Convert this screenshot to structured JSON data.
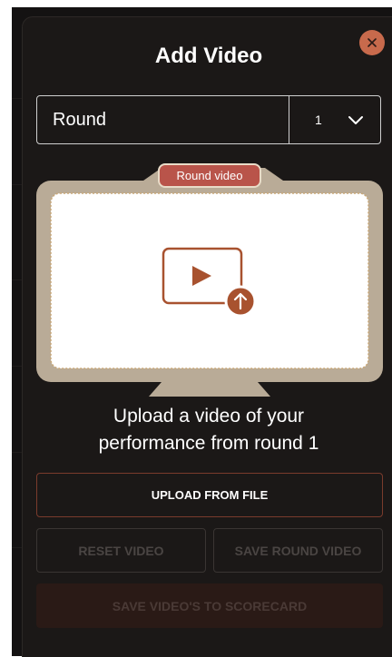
{
  "modal": {
    "title": "Add Video",
    "close_icon": "close-icon"
  },
  "round_select": {
    "label": "Round",
    "value": "1",
    "icon": "chevron-down-icon"
  },
  "preview": {
    "tag": "Round video",
    "icon": "video-upload-icon",
    "accent_color": "#b9544a",
    "frame_color": "#b9ab97"
  },
  "upload_text": {
    "line1": "Upload a video of your",
    "line2": "performance from round 1"
  },
  "buttons": {
    "upload": "UPLOAD FROM FILE",
    "reset": "RESET VIDEO",
    "save_round": "SAVE ROUND VIDEO",
    "save_scorecard": "SAVE VIDEO'S TO SCORECARD"
  }
}
